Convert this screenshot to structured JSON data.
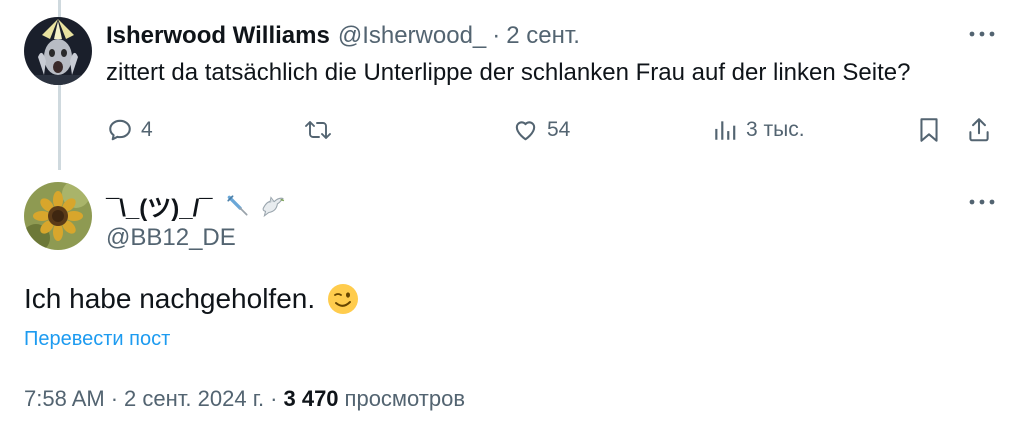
{
  "reply": {
    "author_name": "Isherwood Williams",
    "author_handle": "@Isherwood_",
    "separator": "·",
    "date": "2 сент.",
    "text": "zittert da tatsächlich die Unterlippe der schlanken Frau auf der linken Seite?",
    "actions": {
      "replies": "4",
      "likes": "54",
      "views": "3 тыс."
    }
  },
  "post": {
    "author_name": "¯\\_(ツ)_/¯",
    "author_decor_icons": [
      "syringe-icon",
      "dove-icon"
    ],
    "author_handle": "@BB12_DE",
    "text": "Ich habe nachgeholfen.",
    "text_emoji": "winking-face-icon",
    "translate_label": "Перевести пост",
    "time": "7:58 AM",
    "date": "2 сент. 2024 г.",
    "separator": "·",
    "views_count": "3 470",
    "views_label": "просмотров"
  },
  "colors": {
    "primary_text": "#0f1419",
    "secondary_text": "#536471",
    "link": "#1d9bf0",
    "thread_line": "#cfd9de"
  }
}
